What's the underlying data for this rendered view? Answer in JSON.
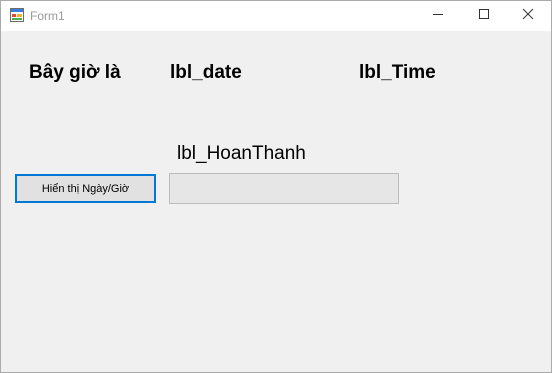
{
  "window": {
    "title": "Form1"
  },
  "labels": {
    "now": "Bây giờ là",
    "date": "lbl_date",
    "time": "lbl_Time",
    "done": "lbl_HoanThanh"
  },
  "buttons": {
    "show_datetime": "Hiển thị Ngày/Giờ"
  },
  "progress": {
    "value_percent": 0
  },
  "colors": {
    "focus_border": "#0078d7",
    "form_background": "#f0f0f0",
    "progress_track": "#e6e6e6"
  },
  "icons": {
    "app": "form-icon",
    "minimize": "minimize-icon",
    "maximize": "maximize-icon",
    "close": "close-icon"
  }
}
